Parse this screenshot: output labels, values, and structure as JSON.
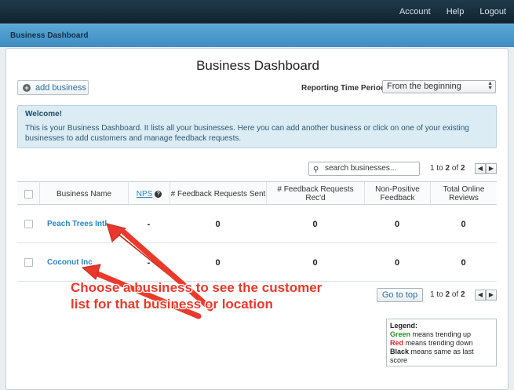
{
  "topnav": {
    "account": "Account",
    "help": "Help",
    "logout": "Logout"
  },
  "section": {
    "title": "Business Dashboard"
  },
  "page": {
    "title": "Business Dashboard"
  },
  "toolbar": {
    "add_business": "add business",
    "reporting_label": "Reporting Time Period",
    "reporting_value": "From the beginning"
  },
  "welcome": {
    "title": "Welcome!",
    "body": "This is your Business Dashboard. It lists all your businesses. Here you can add another business or click on one of your existing businesses to add customers and manage feedback requests."
  },
  "search": {
    "placeholder": "search businesses..."
  },
  "pager_top": {
    "from": "1",
    "to_word": "to",
    "to": "2",
    "of_word": "of",
    "total": "2"
  },
  "pager_bottom": {
    "from": "1",
    "to_word": "to",
    "to": "2",
    "of_word": "of",
    "total": "2"
  },
  "table": {
    "headers": {
      "name": "Business Name",
      "nps": "NPS",
      "sent": "# Feedback Requests Sent",
      "recd": "# Feedback Requests Rec'd",
      "nonpos": "Non-Positive Feedback",
      "reviews": "Total Online Reviews"
    },
    "rows": [
      {
        "name": "Peach Trees Intl.",
        "nps": "-",
        "sent": "0",
        "recd": "0",
        "nonpos": "0",
        "reviews": "0"
      },
      {
        "name": "Coconut Inc",
        "nps": "-",
        "sent": "0",
        "recd": "0",
        "nonpos": "0",
        "reviews": "0"
      }
    ]
  },
  "goto_top": "Go to top",
  "legend": {
    "title": "Legend:",
    "green": "Green",
    "green_text": " means trending up",
    "red": "Red",
    "red_text": " means trending down",
    "black": "Black",
    "black_text": " means same as last score"
  },
  "annotation": {
    "line1": "Choose a business to see the customer",
    "line2": "list for that business or location"
  },
  "colors": {
    "accent": "#4a9bd0",
    "link": "#2a86c1",
    "annotation": "#e9392c",
    "green": "#2a8a2a",
    "red": "#d22"
  }
}
